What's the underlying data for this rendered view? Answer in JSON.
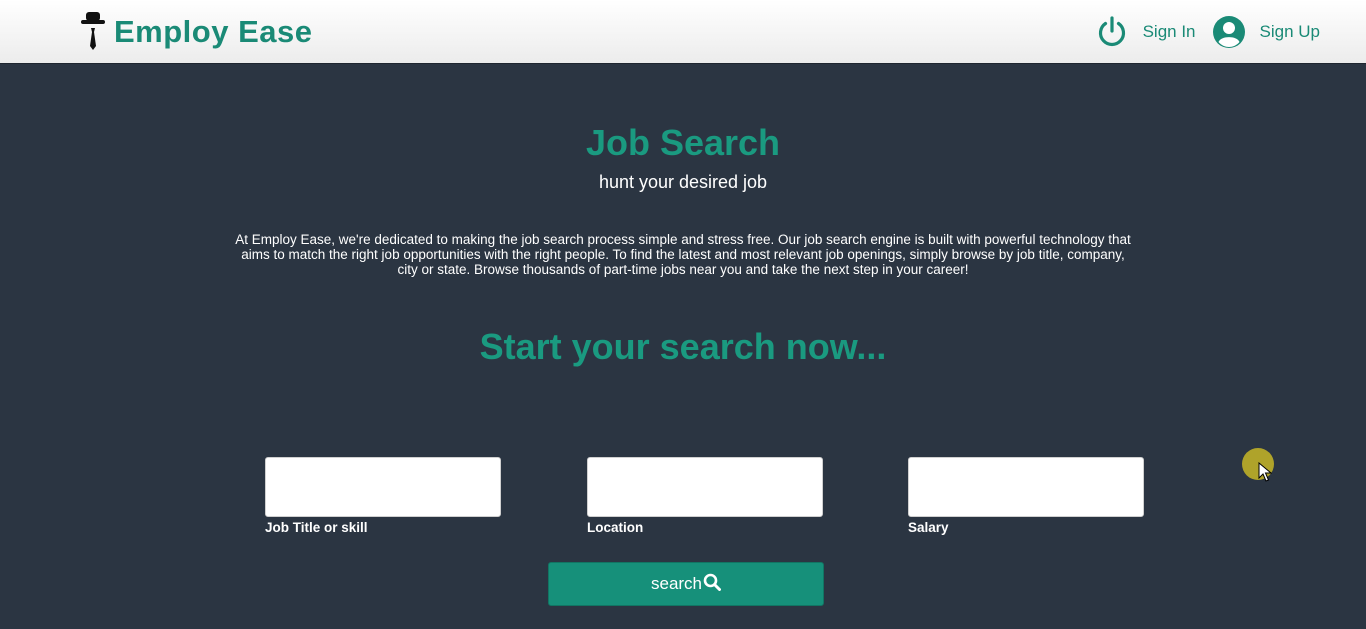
{
  "brand": {
    "name": "Employ Ease",
    "logo_icon": "hat-tie-logo-icon",
    "color": "#1a8a76"
  },
  "nav": {
    "sign_in": {
      "label": "Sign In",
      "icon": "power-icon"
    },
    "sign_up": {
      "label": "Sign Up",
      "icon": "user-circle-icon"
    }
  },
  "hero": {
    "title": "Job Search",
    "subtitle": "hunt your desired job",
    "description": "At Employ Ease, we're dedicated to making the job search process simple and stress free. Our job search engine is built with powerful technology that aims to match the right job opportunities with the right people. To find the latest and most relevant job openings, simply browse by job title, company, city or state. Browse thousands of part-time jobs near you and take the next step in your career!",
    "cta": "Start your search now..."
  },
  "form": {
    "job_title": {
      "label": "Job Title or skill",
      "value": ""
    },
    "location": {
      "label": "Location",
      "value": ""
    },
    "salary": {
      "label": "Salary",
      "value": ""
    },
    "search_button": {
      "label": "search",
      "icon": "search-icon"
    }
  },
  "colors": {
    "accent": "#1a9a80",
    "background": "#2b3542",
    "button": "#16907a"
  }
}
